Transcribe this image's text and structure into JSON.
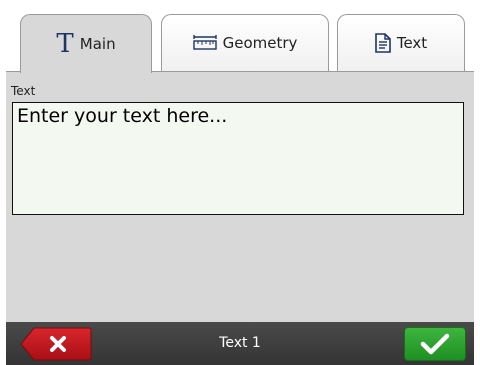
{
  "tabs": [
    {
      "label": "Main",
      "icon": "text-t-icon",
      "active": true
    },
    {
      "label": "Geometry",
      "icon": "ruler-icon",
      "active": false
    },
    {
      "label": "Text",
      "icon": "document-icon",
      "active": false
    }
  ],
  "text_field": {
    "label": "Text",
    "placeholder": "Enter your text here...",
    "value": ""
  },
  "bottom_bar": {
    "title": "Text 1",
    "cancel_icon": "close-icon",
    "ok_icon": "checkmark-icon"
  },
  "colors": {
    "panel_bg": "#d8d8d8",
    "text_area_bg": "#f3f8f1",
    "bottom_bar_bg": "#3a3a3a",
    "cancel_red": "#c0141b",
    "ok_green": "#2aa12e",
    "tab_icon_blue": "#1e3466"
  }
}
